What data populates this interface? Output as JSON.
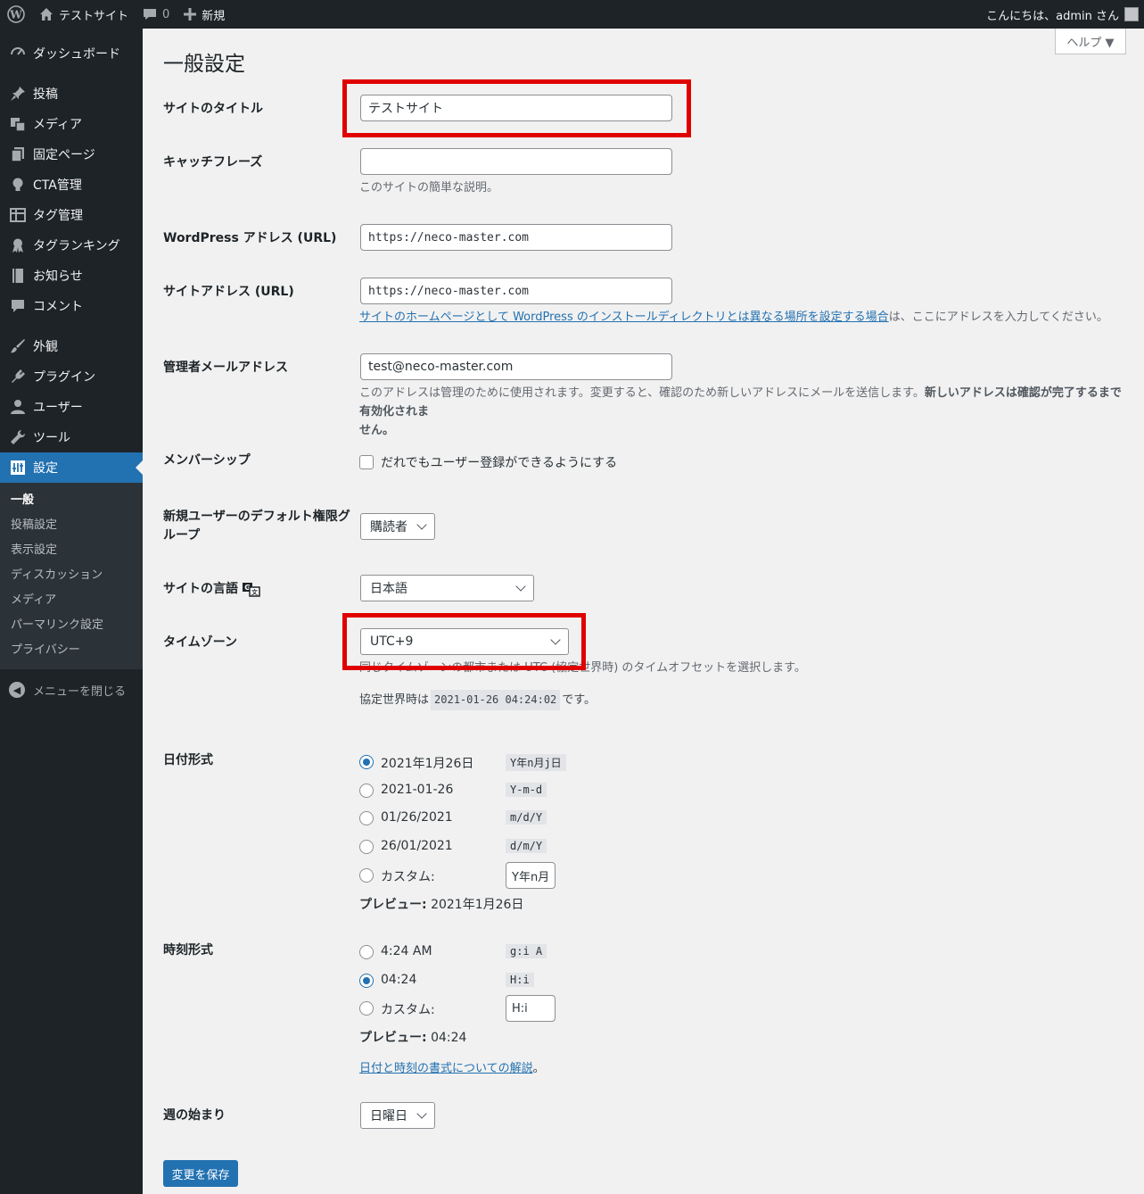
{
  "admin_bar": {
    "site_name": "テストサイト",
    "comments_count": "0",
    "new_label": "新規",
    "greeting": "こんにちは、admin さん"
  },
  "sidebar": {
    "items": [
      {
        "label": "ダッシュボード",
        "icon": "dashboard-icon"
      },
      {
        "label": "投稿",
        "icon": "pin-icon"
      },
      {
        "label": "メディア",
        "icon": "media-icon"
      },
      {
        "label": "固定ページ",
        "icon": "pages-icon"
      },
      {
        "label": "CTA管理",
        "icon": "lightbulb-icon"
      },
      {
        "label": "タグ管理",
        "icon": "table-icon"
      },
      {
        "label": "タグランキング",
        "icon": "award-icon"
      },
      {
        "label": "お知らせ",
        "icon": "book-icon"
      },
      {
        "label": "コメント",
        "icon": "comment-icon"
      },
      {
        "label": "外観",
        "icon": "brush-icon"
      },
      {
        "label": "プラグイン",
        "icon": "plugin-icon"
      },
      {
        "label": "ユーザー",
        "icon": "user-icon"
      },
      {
        "label": "ツール",
        "icon": "wrench-icon"
      },
      {
        "label": "設定",
        "icon": "settings-icon"
      }
    ],
    "submenu": [
      "一般",
      "投稿設定",
      "表示設定",
      "ディスカッション",
      "メディア",
      "パーマリンク設定",
      "プライバシー"
    ],
    "collapse_label": "メニューを閉じる"
  },
  "help_label": "ヘルプ ▼",
  "page_title": "一般設定",
  "fields": {
    "site_title": {
      "label": "サイトのタイトル",
      "value": "テストサイト"
    },
    "tagline": {
      "label": "キャッチフレーズ",
      "value": "",
      "desc": "このサイトの簡単な説明。"
    },
    "wp_url": {
      "label": "WordPress アドレス (URL)",
      "value": "https://neco-master.com"
    },
    "site_url": {
      "label": "サイトアドレス (URL)",
      "value": "https://neco-master.com",
      "desc_link": "サイトのホームページとして WordPress のインストールディレクトリとは異なる場所を設定する場合",
      "desc_rest": "は、ここにアドレスを入力してください。"
    },
    "admin_email": {
      "label": "管理者メールアドレス",
      "value": "test@neco-master.com",
      "desc_line1_normal": "このアドレスは管理のために使用されます。変更すると、確認のため新しいアドレスにメールを送信します。",
      "desc_line1_bold": "新しいアドレスは確認が完了するまで有効化されま",
      "desc_line2_bold": "せん。"
    },
    "membership": {
      "label": "メンバーシップ",
      "checkbox_label": "だれでもユーザー登録ができるようにする"
    },
    "default_role": {
      "label_line1": "新規ユーザーのデフォルト権限グ",
      "label_line2": "ループ",
      "value": "購読者"
    },
    "site_language": {
      "label": "サイトの言語",
      "value": "日本語"
    },
    "timezone": {
      "label": "タイムゾーン",
      "value": "UTC+9",
      "desc": "同じタイムゾーンの都市または UTC (協定世界時) のタイムオフセットを選択します。",
      "utc_prefix": "協定世界時は",
      "utc_time": "2021-01-26 04:24:02",
      "utc_suffix": "です。"
    },
    "date_format": {
      "label": "日付形式",
      "options": [
        {
          "label": "2021年1月26日",
          "code": "Y年n月j日"
        },
        {
          "label": "2021-01-26",
          "code": "Y-m-d"
        },
        {
          "label": "01/26/2021",
          "code": "m/d/Y"
        },
        {
          "label": "26/01/2021",
          "code": "d/m/Y"
        },
        {
          "label": "カスタム:",
          "code": "Y年n月"
        }
      ],
      "preview_label": "プレビュー:",
      "preview_value": "2021年1月26日"
    },
    "time_format": {
      "label": "時刻形式",
      "options": [
        {
          "label": "4:24 AM",
          "code": "g:i A"
        },
        {
          "label": "04:24",
          "code": "H:i"
        },
        {
          "label": "カスタム:",
          "code": "H:i"
        }
      ],
      "preview_label": "プレビュー:",
      "preview_value": "04:24",
      "doc_link": "日付と時刻の書式についての解説",
      "doc_suffix": "。"
    },
    "start_of_week": {
      "label": "週の始まり",
      "value": "日曜日"
    }
  },
  "save_button": "変更を保存",
  "colors": {
    "accent": "#2271b1",
    "highlight": "#e00000",
    "sidebar": "#1d2327"
  }
}
